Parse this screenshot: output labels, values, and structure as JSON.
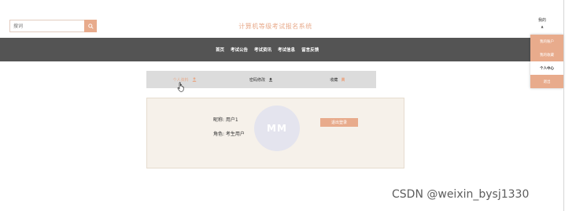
{
  "header": {
    "search": {
      "value": "",
      "placeholder": "搜词"
    },
    "site_title": "计算机等级考试报名系统"
  },
  "nav": {
    "items": [
      {
        "label": "首页"
      },
      {
        "label": "考试公告"
      },
      {
        "label": "考试资讯"
      },
      {
        "label": "考试信息"
      },
      {
        "label": "留言反馈"
      }
    ]
  },
  "user_menu": {
    "trigger_label": "我的",
    "caret": "▲",
    "items": [
      {
        "label": "我的账户"
      },
      {
        "label": "我的收藏"
      },
      {
        "label": "个人中心"
      },
      {
        "label": "退出"
      }
    ]
  },
  "tabs": [
    {
      "label": "个人资料",
      "icon": "user-icon",
      "active": true
    },
    {
      "label": "密码修改",
      "icon": "upload-icon",
      "active": false
    },
    {
      "label": "收藏",
      "icon": "bookmark-icon",
      "active": false
    }
  ],
  "profile": {
    "name_line": "昵称: 用户1",
    "role_line": "角色: 考生用户",
    "avatar_initials": "MM",
    "logout_label": "退出登录"
  },
  "watermark": "CSDN @weixin_bysj1330",
  "colors": {
    "accent": "#e8ab8c",
    "navbar": "#545454",
    "panel": "#f6f1ea",
    "tab_bar": "#dcdcdc"
  }
}
